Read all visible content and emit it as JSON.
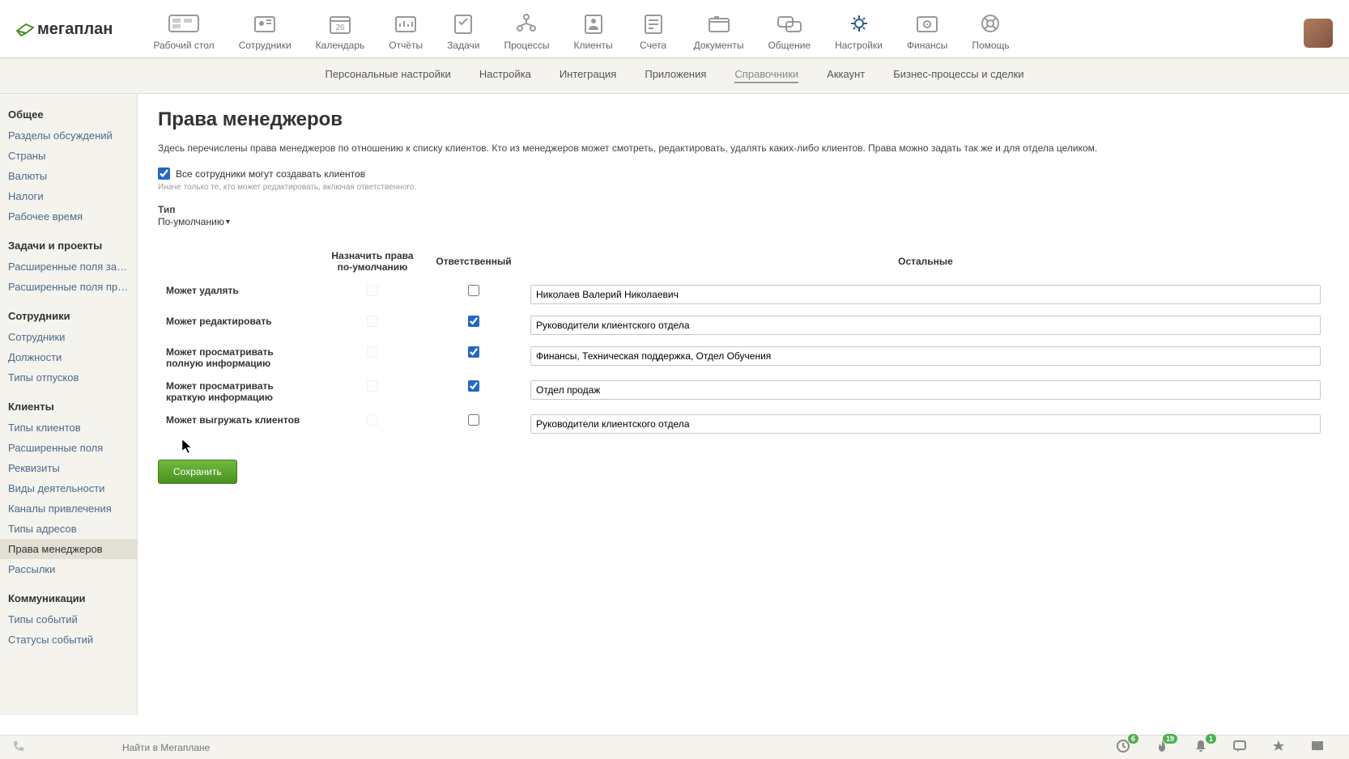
{
  "logo_text": "мегаплан",
  "top_nav": [
    {
      "label": "Рабочий стол"
    },
    {
      "label": "Сотрудники"
    },
    {
      "label": "Календарь"
    },
    {
      "label": "Отчёты"
    },
    {
      "label": "Задачи"
    },
    {
      "label": "Процессы"
    },
    {
      "label": "Клиенты"
    },
    {
      "label": "Счета"
    },
    {
      "label": "Документы"
    },
    {
      "label": "Общение"
    },
    {
      "label": "Настройки"
    },
    {
      "label": "Финансы"
    },
    {
      "label": "Помощь"
    }
  ],
  "sub_nav": [
    {
      "label": "Персональные настройки"
    },
    {
      "label": "Настройка"
    },
    {
      "label": "Интеграция"
    },
    {
      "label": "Приложения"
    },
    {
      "label": "Справочники",
      "active": true
    },
    {
      "label": "Аккаунт"
    },
    {
      "label": "Бизнес-процессы и сделки"
    }
  ],
  "sidebar": [
    {
      "header": "Общее",
      "items": [
        {
          "label": "Разделы обсуждений"
        },
        {
          "label": "Страны"
        },
        {
          "label": "Валюты"
        },
        {
          "label": "Налоги"
        },
        {
          "label": "Рабочее время"
        }
      ]
    },
    {
      "header": "Задачи и проекты",
      "items": [
        {
          "label": "Расширенные поля задач"
        },
        {
          "label": "Расширенные поля проек…"
        }
      ]
    },
    {
      "header": "Сотрудники",
      "items": [
        {
          "label": "Сотрудники"
        },
        {
          "label": "Должности"
        },
        {
          "label": "Типы отпусков"
        }
      ]
    },
    {
      "header": "Клиенты",
      "items": [
        {
          "label": "Типы клиентов"
        },
        {
          "label": "Расширенные поля"
        },
        {
          "label": "Реквизиты"
        },
        {
          "label": "Виды деятельности"
        },
        {
          "label": "Каналы привлечения"
        },
        {
          "label": "Типы адресов"
        },
        {
          "label": "Права менеджеров",
          "active": true
        },
        {
          "label": "Рассылки"
        }
      ]
    },
    {
      "header": "Коммуникации",
      "items": [
        {
          "label": "Типы событий"
        },
        {
          "label": "Статусы событий"
        }
      ]
    }
  ],
  "page": {
    "title": "Права менеджеров",
    "description": "Здесь перечислены права менеджеров по отношению к списку клиентов. Кто из менеджеров может смотреть, редактировать, удалять каких-либо клиентов. Права можно задать так же и для отдела целиком.",
    "all_can_create_label": "Все сотрудники могут создавать клиентов",
    "all_can_create_checked": true,
    "hint": "Иначе только те, кто может редактировать, включая ответственного.",
    "type_label": "Тип",
    "type_value": "По-умолчанию",
    "headers": [
      "",
      "Назначить права по-умолчанию",
      "Ответственный",
      "Остальные"
    ],
    "rows": [
      {
        "label": "Может удалять",
        "default_cb": false,
        "default_disabled": true,
        "resp_cb": false,
        "others": "Николаев Валерий Николаевич"
      },
      {
        "label": "Может редактировать",
        "default_cb": false,
        "default_disabled": true,
        "resp_cb": true,
        "others": "Руководители клиентского отдела"
      },
      {
        "label": "Может просматривать полную информацию",
        "default_cb": false,
        "default_disabled": true,
        "resp_cb": true,
        "others": "Финансы, Техническая поддержка, Отдел Обучения"
      },
      {
        "label": "Может просматривать краткую информацию",
        "default_cb": false,
        "default_disabled": true,
        "resp_cb": true,
        "others": "Отдел продаж"
      },
      {
        "label": "Может выгружать клиентов",
        "default_cb": false,
        "default_disabled": true,
        "resp_cb": false,
        "others": "Руководители клиентского отдела"
      }
    ],
    "save_label": "Сохранить"
  },
  "footer": {
    "search_placeholder": "Найти в Мегаплане",
    "badges": {
      "clock": "6",
      "fire": "19",
      "bell": "1"
    }
  }
}
